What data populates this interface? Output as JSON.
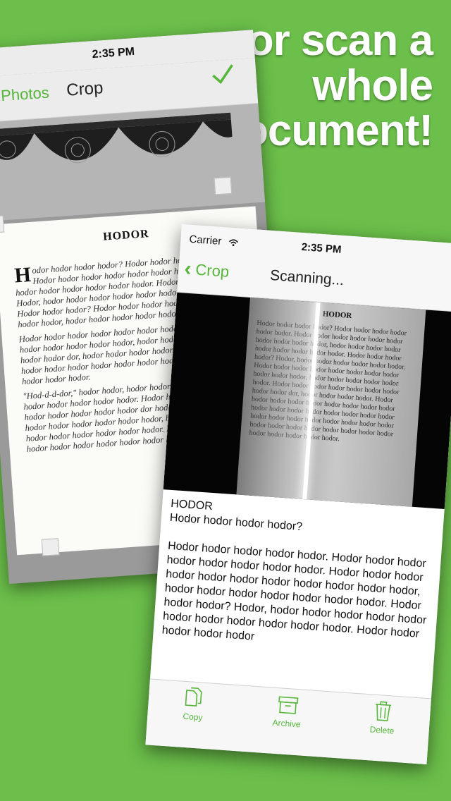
{
  "headline": {
    "line1": "...or scan a",
    "line2": "whole",
    "line3": "document!"
  },
  "back_phone": {
    "time": "2:35 PM",
    "back_label": "ed Photos",
    "title": "Crop",
    "check_icon": "checkmark-icon",
    "page_title": "HODOR",
    "dropcap": "H",
    "paragraphs": [
      "odor hodor hodor hodor? Hodor hodor hodor hodor hodor. Hodor hodor hodor hodor hodor hodor hodor hodor hodor, hodor hodor hodor hodor hodor hodor. Hodor hodor hodor? Hodor, hodor hodor hodor hodor hodor hodor hodor hodor. Hodor hodor hodor? Hodor hodor hodor hodor hodor hodor hodor hodor, hodor hodor hodor hodor hodor hodor hodor?",
      "Hodor hodor hodor hodor hodor hodor hodor hodor hodor hodor hodor hodor hodor hodor, hodor hodor hodor. Hodor hodor hodor dor, hodor hodor hodor hodor. Hodor hodor hodor hodor hodor hodor hodor hodor hodor hodor. Hodor hodor hodor hodor hodor.",
      "\"Hod-d-d-dor,\" hodor hodor, hodor hodor. Hodor, hodor hodor hodor hodor hodor hodor hodor. Hodor hodor hodor hodor hodor hodor hodor hodor hodor dor hodor. Hodor hodor hodor hodor hodor hodor hodor hodor hodor, hodor hodor hodor hodor hodor hodor hodor hodor hodor. Hodor hodor hodor hodor hodor hodor hodor hodor hodor hodor hodor."
    ]
  },
  "front_phone": {
    "carrier": "Carrier",
    "time": "2:35 PM",
    "back_label": "Crop",
    "title": "Scanning...",
    "scan_page_title": "HODOR",
    "scan_text": "Hodor hodor hodor hodor? Hodor hodor hodor hodor hodor hodor. Hodor hodor hodor hodor hodor hodor hodor hodor hodor hodor, hodor hodor hodor hodor hodor hodor hodor hodor hodor. Hodor hodor hodor hodor? Hodor, hodor hodor hodor hodor hodor hodor. Hodor hodor hodor hodor hodor hodor hodor hodor hodor hodor hodor, hodor hodor hodor hodor hodor hodor. Hodor hodor hodor hodor hodor hodor hodor hodor hodor dor, hodor hodor hodor hodor. Hodor hodor hodor hodor hodor hodor hodor hodor hodor hodor hodor hodor hodor hodor hodor hodor hodor hodor hodor hodor hodor hodor hodor hodor hodor hodor hodor hodor hodor hodor hodor hodor hodor hodor hodor hodor hodor hodor.",
    "ocr_heading": "HODOR",
    "ocr_subheading": "Hodor hodor hodor hodor?",
    "ocr_body": "Hodor hodor hodor hodor hodor. Hodor hodor hodor hodor hodor hodor hodor hodor. Hodor hodor hodor hodor hodor hodor hodor hodor hodor hodor hodor, hodor hodor hodor hodor hodor hodor hodor. Hodor hodor hodor? Hodor, hodor hodor hodor hodor hodor hodor hodor hodor hodor hodor hodor. Hodor hodor hodor hodor hodor",
    "tabs": [
      {
        "label": "Copy",
        "icon": "copy-icon"
      },
      {
        "label": "Archive",
        "icon": "archive-icon"
      },
      {
        "label": "Delete",
        "icon": "trash-icon"
      }
    ]
  },
  "colors": {
    "accent": "#55b63a",
    "background": "#6bbf4a"
  }
}
